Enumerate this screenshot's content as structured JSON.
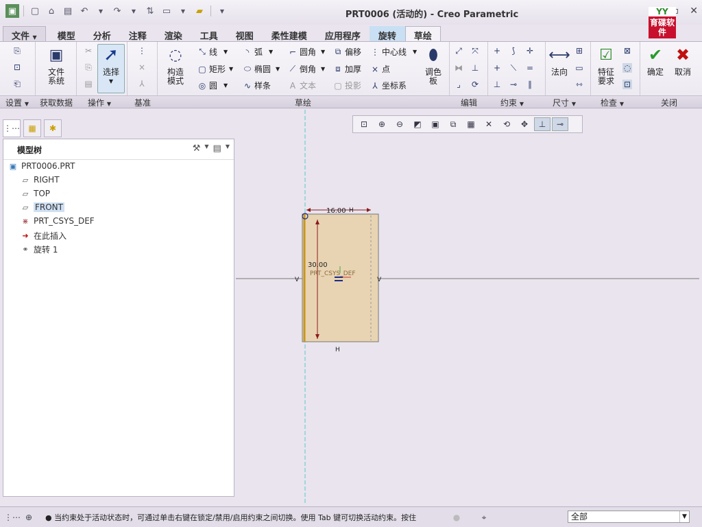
{
  "window": {
    "title": "PRT0006 (活动的) - Creo Parametric",
    "controls": [
      "–",
      "▫",
      "✕"
    ]
  },
  "logo": {
    "top": "YY",
    "text": "育碟软件"
  },
  "tabs": [
    {
      "label": "文件"
    },
    {
      "label": "模型"
    },
    {
      "label": "分析"
    },
    {
      "label": "注释"
    },
    {
      "label": "渲染"
    },
    {
      "label": "工具"
    },
    {
      "label": "视图"
    },
    {
      "label": "柔性建模"
    },
    {
      "label": "应用程序"
    },
    {
      "label": "旋转"
    },
    {
      "label": "草绘"
    }
  ],
  "ribbon": {
    "file_system": "文件\n系统",
    "select": "选择",
    "construction_mode": "构造\n模式",
    "line": "线",
    "arc": "弧",
    "fillet": "圆角",
    "offset": "偏移",
    "centerline": "中心线",
    "rectangle": "矩形",
    "ellipse": "椭圆",
    "chamfer": "倒角",
    "thicken": "加厚",
    "point": "点",
    "circle": "圆",
    "spline": "样条",
    "text": "文本",
    "project": "投影",
    "csys": "坐标系",
    "palette": "调色\n板",
    "normal": "法向",
    "feature_req": "特征\n要求",
    "ok": "确定",
    "cancel": "取消",
    "groups": {
      "setup": "设置",
      "get_data": "获取数据",
      "operations": "操作",
      "datum": "基准",
      "sketching": "草绘",
      "editing": "编辑",
      "constrain": "约束",
      "dimension": "尺寸",
      "inspect": "检查",
      "close": "关闭"
    }
  },
  "tree": {
    "title": "模型树",
    "items": [
      {
        "label": "PRT0006.PRT",
        "icon": "part-icon"
      },
      {
        "label": "RIGHT",
        "icon": "datum-plane-icon"
      },
      {
        "label": "TOP",
        "icon": "datum-plane-icon"
      },
      {
        "label": "FRONT",
        "icon": "datum-plane-icon",
        "selected": true
      },
      {
        "label": "PRT_CSYS_DEF",
        "icon": "csys-icon"
      },
      {
        "label": "在此插入",
        "icon": "insert-arrow-icon"
      },
      {
        "label": "旋转 1",
        "icon": "revolve-icon"
      }
    ]
  },
  "sketch": {
    "width_dim": "16.00",
    "height_dim": "30.00",
    "csys_label": "PRT_CSYS_DEF",
    "h_label_top": "H",
    "h_label_bottom": "H",
    "v_label_left": "V",
    "v_label_right": "V",
    "fill_color": "#e8d4b2",
    "edge_color": "#c8961e",
    "dim_color": "#8b1a1a",
    "centerline_color": "#5bc8c8"
  },
  "status": {
    "message": "● 当约束处于活动状态时，可通过单击右键在锁定/禁用/启用约束之间切换。使用 Tab 键可切换活动约束。按住",
    "filter": "全部"
  }
}
